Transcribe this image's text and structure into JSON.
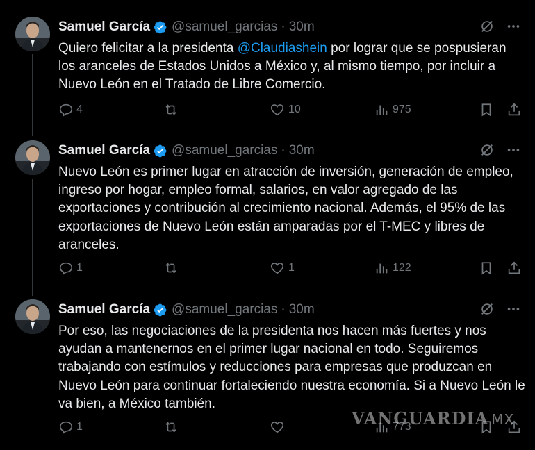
{
  "author": {
    "name": "Samuel García",
    "handle": "@samuel_garcias",
    "separator": "·"
  },
  "colors": {
    "background": "#000000",
    "text": "#e7e9ea",
    "muted": "#71767b",
    "accent": "#1d9bf0"
  },
  "icons": {
    "verified": "verified-badge-icon",
    "grok": "grok-icon",
    "more": "more-icon",
    "reply": "reply-icon",
    "repost": "repost-icon",
    "like": "like-icon",
    "views": "views-icon",
    "bookmark": "bookmark-icon",
    "share": "share-icon"
  },
  "tweets": [
    {
      "time": "30m",
      "text_before": "Quiero felicitar a la presidenta ",
      "mention": "@Claudiashein",
      "text_after": " por lograr que se pospusieran los aranceles de Estados Unidos a México y, al mismo tiempo, por incluir a Nuevo León en el Tratado de Libre Comercio.",
      "replies": "4",
      "reposts": "",
      "likes": "10",
      "views": "975"
    },
    {
      "time": "30m",
      "text_before": "Nuevo León es primer lugar en atracción de inversión, generación de empleo, ingreso por hogar, empleo formal, salarios, en valor agregado de las exportaciones y contribución al crecimiento nacional. Además, el 95% de las exportaciones de Nuevo León están amparadas por el T-MEC y libres de aranceles.",
      "mention": "",
      "text_after": "",
      "replies": "1",
      "reposts": "",
      "likes": "1",
      "views": "122"
    },
    {
      "time": "30m",
      "text_before": "Por eso, las negociaciones de la presidenta nos hacen más fuertes y nos ayudan a mantenernos en el primer lugar nacional en todo. Seguiremos trabajando con estímulos y reducciones para empresas que produzcan en Nuevo León para continuar fortaleciendo nuestra economía. Si a Nuevo León le va bien, a México también.",
      "mention": "",
      "text_after": "",
      "replies": "1",
      "reposts": "",
      "likes": "",
      "views": "773"
    }
  ],
  "watermark": {
    "text": "VANGUARDIA",
    "suffix": "MX"
  }
}
